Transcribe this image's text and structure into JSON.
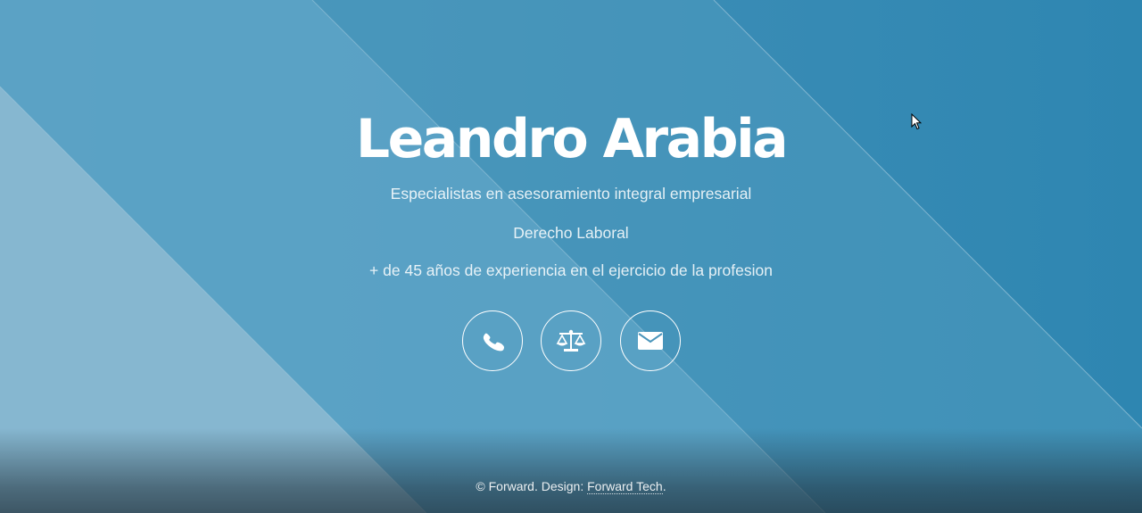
{
  "hero": {
    "title": "Leandro Arabia",
    "tagline": "Especialistas en asesoramiento integral empresarial",
    "practice_area": "Derecho Laboral",
    "experience": "+ de 45 años de experiencia en el ejercicio de la profesion"
  },
  "actions": [
    {
      "icon": "phone-icon"
    },
    {
      "icon": "scales-of-justice-icon"
    },
    {
      "icon": "envelope-icon"
    }
  ],
  "footer": {
    "copyright": "© Forward. Design:",
    "credit_link": "Forward Tech",
    "period": "."
  },
  "colors": {
    "background_dark": "#2f86b0",
    "background_mid": "#4a95bb",
    "background_light": "#86b6cf",
    "text": "#ffffff"
  }
}
